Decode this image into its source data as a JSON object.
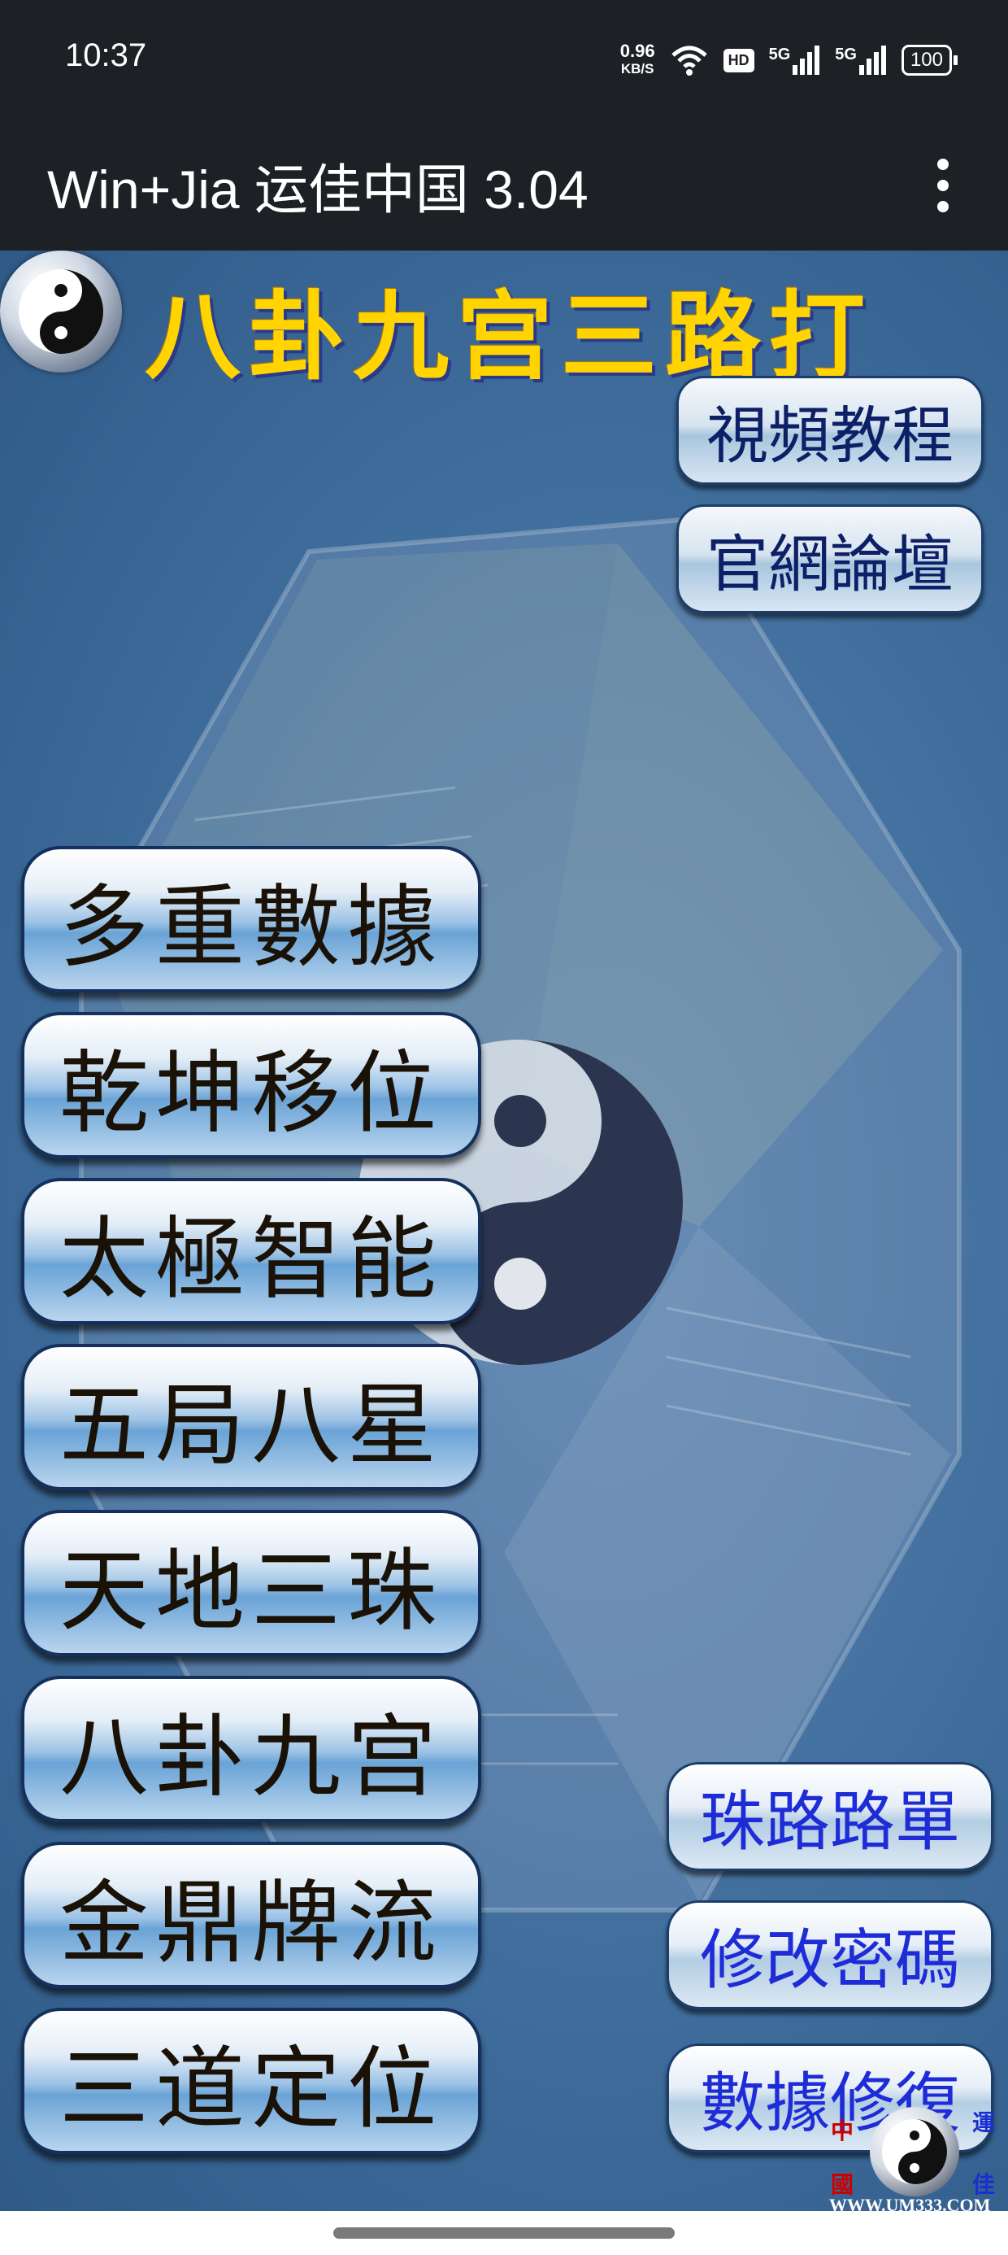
{
  "status_bar": {
    "time": "10:37",
    "net_speed_value": "0.96",
    "net_speed_unit": "KB/S",
    "hd_label": "HD",
    "signal1_label": "5G",
    "signal2_label": "5G",
    "battery": "100"
  },
  "app_bar": {
    "title": "Win+Jia 运佳中国 3.04"
  },
  "banner": {
    "title": "八卦九宫三路打"
  },
  "top_buttons": {
    "video": "視頻教程",
    "forum": "官網論壇"
  },
  "menu": {
    "items": [
      {
        "label": "多重數據"
      },
      {
        "label": "乾坤移位"
      },
      {
        "label": "太極智能"
      },
      {
        "label": "五局八星"
      },
      {
        "label": "天地三珠"
      },
      {
        "label": "八卦九宫"
      },
      {
        "label": "金鼎牌流"
      },
      {
        "label": "三道定位"
      }
    ]
  },
  "side_buttons": {
    "road_sheet": "珠路路單",
    "change_password": "修改密碼",
    "data_repair": "數據修復"
  },
  "corner_logo": {
    "chars": [
      "中",
      "運",
      "國",
      "佳"
    ],
    "url": "WWW.UM333.COM"
  },
  "colors": {
    "banner_title": "#ffd400",
    "side_button_text": "#1e2cd8",
    "menu_text": "#1a1207",
    "bar_bg": "#1d2024"
  }
}
